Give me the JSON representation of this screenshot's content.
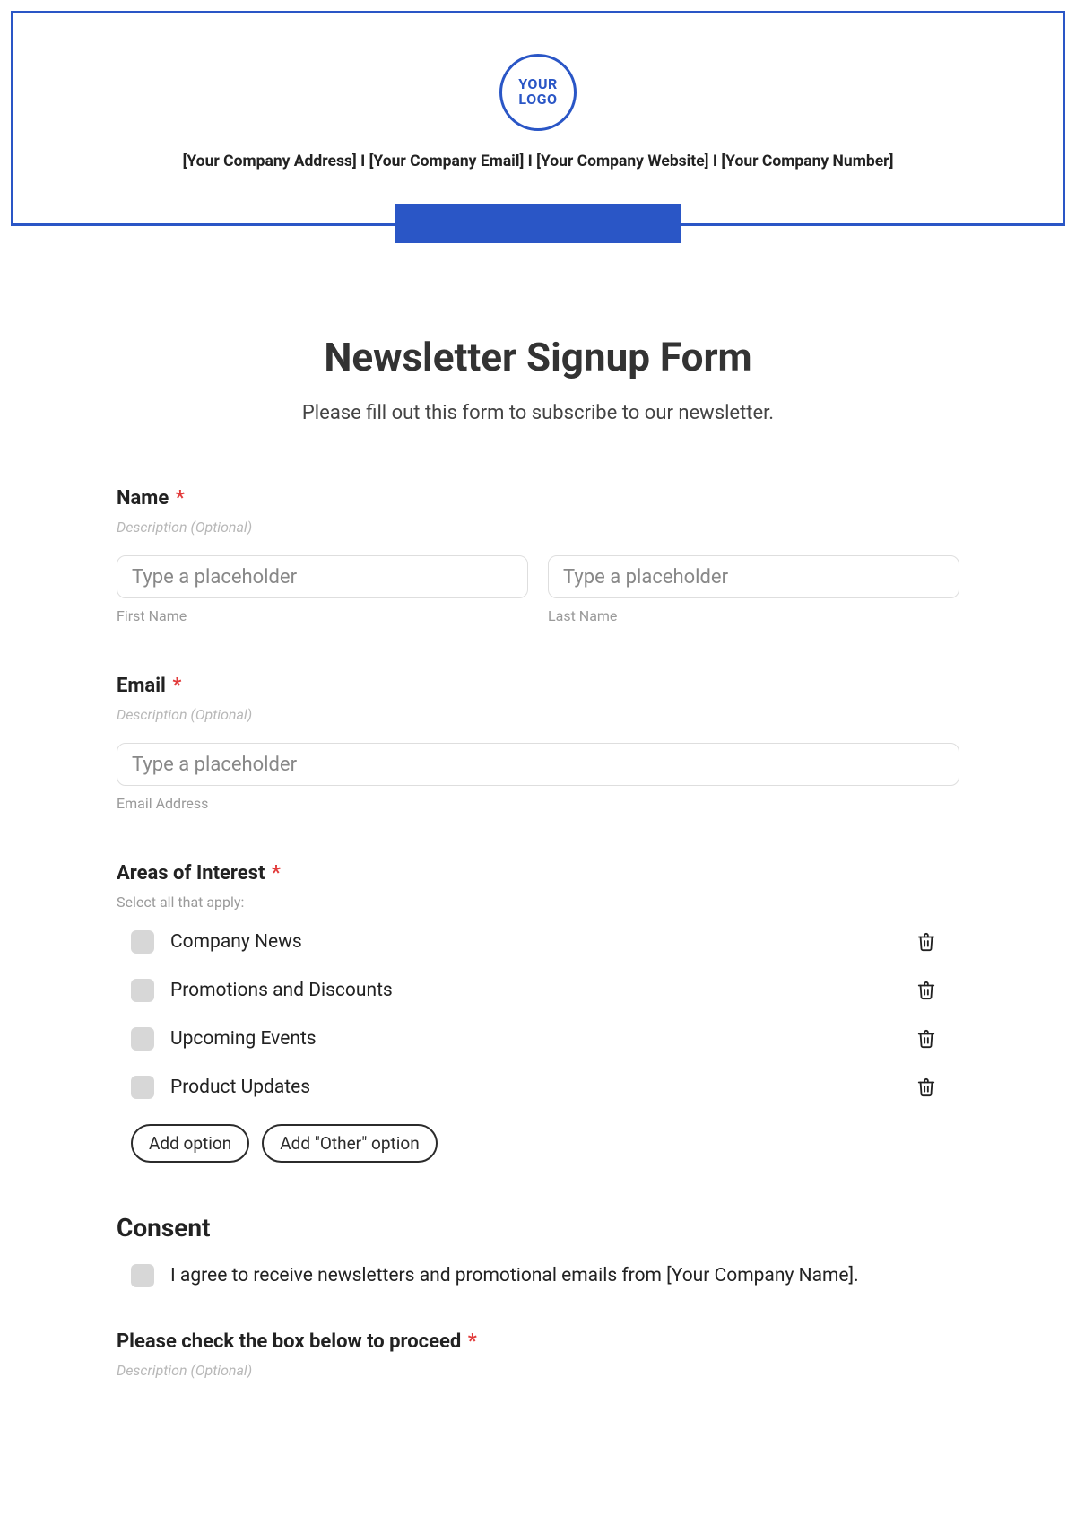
{
  "banner": {
    "logo_line1": "YOUR",
    "logo_line2": "LOGO",
    "company_line": "[Your Company Address] I [Your Company Email] I [Your Company Website] I [Your Company Number]"
  },
  "form": {
    "title": "Newsletter Signup Form",
    "subtitle": "Please fill out this form to subscribe to our newsletter.",
    "name_section": {
      "label": "Name",
      "description": "Description (Optional)",
      "first_placeholder": "Type a placeholder",
      "first_sub": "First Name",
      "last_placeholder": "Type a placeholder",
      "last_sub": "Last Name"
    },
    "email_section": {
      "label": "Email",
      "description": "Description (Optional)",
      "placeholder": "Type a placeholder",
      "sub": "Email Address"
    },
    "interests_section": {
      "label": "Areas of Interest",
      "description": "Select all that apply:",
      "options": [
        "Company News",
        "Promotions and Discounts",
        "Upcoming Events",
        "Product Updates"
      ],
      "add_option_label": "Add option",
      "add_other_label": "Add \"Other\" option"
    },
    "consent_section": {
      "heading": "Consent",
      "text": "I agree to receive newsletters and promotional emails from [Your Company Name]."
    },
    "proceed_section": {
      "label": "Please check the box below to proceed",
      "description": "Description (Optional)"
    },
    "required_mark": "*"
  }
}
